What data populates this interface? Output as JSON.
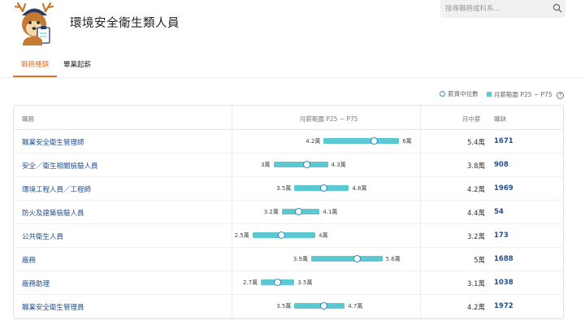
{
  "header": {
    "title": "環境安全衛生類人員",
    "search_placeholder": "搜尋職務或科系..."
  },
  "tabs": [
    {
      "label": "職務種類",
      "active": true
    },
    {
      "label": "畢業起薪",
      "active": false
    }
  ],
  "legend": {
    "median_label": "薪資中位數",
    "range_label": "月薪範圍 P25 ~ P75"
  },
  "table": {
    "headers": {
      "job": "職務",
      "range": "月薪範圍 P25 ~ P75",
      "median": "月中薪",
      "count": "職缺"
    },
    "rows": [
      {
        "name": "職業安全衛生管理師",
        "p25": 4.2,
        "median": 5.4,
        "p75": 6.0,
        "p25_label": "4.2萬",
        "p75_label": "6萬",
        "median_label": "5.4萬",
        "count": "1671"
      },
      {
        "name": "安全／衛生相關檢驗人員",
        "p25": 3.0,
        "median": 3.8,
        "p75": 4.3,
        "p25_label": "3萬",
        "p75_label": "4.3萬",
        "median_label": "3.8萬",
        "count": "908"
      },
      {
        "name": "環境工程人員／工程師",
        "p25": 3.5,
        "median": 4.2,
        "p75": 4.8,
        "p25_label": "3.5萬",
        "p75_label": "4.8萬",
        "median_label": "4.2萬",
        "count": "1969"
      },
      {
        "name": "防火及建築檢驗人員",
        "p25": 3.2,
        "median": 3.6,
        "p75": 4.1,
        "p25_label": "3.2萬",
        "p75_label": "4.1萬",
        "median_label": "4.4萬",
        "count": "54"
      },
      {
        "name": "公共衛生人員",
        "p25": 2.5,
        "median": 3.2,
        "p75": 4.0,
        "p25_label": "2.5萬",
        "p75_label": "4萬",
        "median_label": "3.2萬",
        "count": "173"
      },
      {
        "name": "廠務",
        "p25": 3.9,
        "median": 5.0,
        "p75": 5.6,
        "p25_label": "3.9萬",
        "p75_label": "5.6萬",
        "median_label": "5萬",
        "count": "1688"
      },
      {
        "name": "廠務助理",
        "p25": 2.7,
        "median": 3.1,
        "p75": 3.5,
        "p25_label": "2.7萬",
        "p75_label": "3.5萬",
        "median_label": "3.1萬",
        "count": "1038"
      },
      {
        "name": "職業安全衛生管理員",
        "p25": 3.5,
        "median": 4.2,
        "p75": 4.7,
        "p25_label": "3.5萬",
        "p75_label": "4.7萬",
        "median_label": "4.2萬",
        "count": "1972"
      }
    ]
  },
  "colors": {
    "accent": "#e0742b",
    "range_bar": "#5bc8d2",
    "median_dot": "#2a86c8",
    "link": "#1f4f93"
  }
}
